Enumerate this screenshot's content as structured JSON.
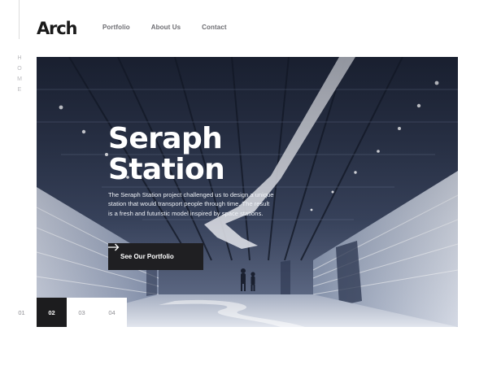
{
  "brand": {
    "logo_text": "Arch"
  },
  "nav": {
    "items": [
      "Portfolio",
      "About Us",
      "Contact"
    ]
  },
  "side_label": {
    "letters": [
      "H",
      "O",
      "M",
      "E"
    ]
  },
  "hero": {
    "title_line1": "Seraph",
    "title_line2": "Station",
    "description": "The Seraph Station project challenged us to design a unique station that would transport people through time. The result is a fresh and futuristic model inspired by space stations.",
    "cta_label": "See Our Portfolio",
    "cta_icon": "arrow-right-icon"
  },
  "pager": {
    "items": [
      "01",
      "02",
      "03",
      "04"
    ],
    "active_index": 1
  },
  "colors": {
    "dark": "#1c1c1e",
    "muted_text": "#6d6d72",
    "white": "#ffffff"
  }
}
